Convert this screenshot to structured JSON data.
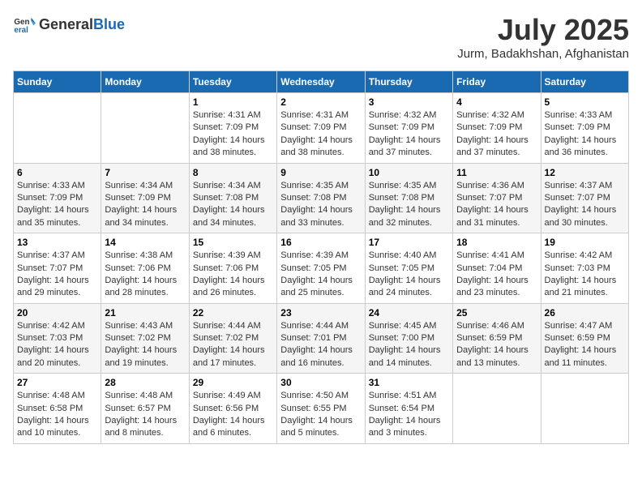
{
  "header": {
    "logo": {
      "general": "General",
      "blue": "Blue"
    },
    "title": "July 2025",
    "location": "Jurm, Badakhshan, Afghanistan"
  },
  "days_of_week": [
    "Sunday",
    "Monday",
    "Tuesday",
    "Wednesday",
    "Thursday",
    "Friday",
    "Saturday"
  ],
  "weeks": [
    [
      null,
      null,
      {
        "day": 1,
        "sunrise": "4:31 AM",
        "sunset": "7:09 PM",
        "daylight": "14 hours and 38 minutes."
      },
      {
        "day": 2,
        "sunrise": "4:31 AM",
        "sunset": "7:09 PM",
        "daylight": "14 hours and 38 minutes."
      },
      {
        "day": 3,
        "sunrise": "4:32 AM",
        "sunset": "7:09 PM",
        "daylight": "14 hours and 37 minutes."
      },
      {
        "day": 4,
        "sunrise": "4:32 AM",
        "sunset": "7:09 PM",
        "daylight": "14 hours and 37 minutes."
      },
      {
        "day": 5,
        "sunrise": "4:33 AM",
        "sunset": "7:09 PM",
        "daylight": "14 hours and 36 minutes."
      }
    ],
    [
      {
        "day": 6,
        "sunrise": "4:33 AM",
        "sunset": "7:09 PM",
        "daylight": "14 hours and 35 minutes."
      },
      {
        "day": 7,
        "sunrise": "4:34 AM",
        "sunset": "7:09 PM",
        "daylight": "14 hours and 34 minutes."
      },
      {
        "day": 8,
        "sunrise": "4:34 AM",
        "sunset": "7:08 PM",
        "daylight": "14 hours and 34 minutes."
      },
      {
        "day": 9,
        "sunrise": "4:35 AM",
        "sunset": "7:08 PM",
        "daylight": "14 hours and 33 minutes."
      },
      {
        "day": 10,
        "sunrise": "4:35 AM",
        "sunset": "7:08 PM",
        "daylight": "14 hours and 32 minutes."
      },
      {
        "day": 11,
        "sunrise": "4:36 AM",
        "sunset": "7:07 PM",
        "daylight": "14 hours and 31 minutes."
      },
      {
        "day": 12,
        "sunrise": "4:37 AM",
        "sunset": "7:07 PM",
        "daylight": "14 hours and 30 minutes."
      }
    ],
    [
      {
        "day": 13,
        "sunrise": "4:37 AM",
        "sunset": "7:07 PM",
        "daylight": "14 hours and 29 minutes."
      },
      {
        "day": 14,
        "sunrise": "4:38 AM",
        "sunset": "7:06 PM",
        "daylight": "14 hours and 28 minutes."
      },
      {
        "day": 15,
        "sunrise": "4:39 AM",
        "sunset": "7:06 PM",
        "daylight": "14 hours and 26 minutes."
      },
      {
        "day": 16,
        "sunrise": "4:39 AM",
        "sunset": "7:05 PM",
        "daylight": "14 hours and 25 minutes."
      },
      {
        "day": 17,
        "sunrise": "4:40 AM",
        "sunset": "7:05 PM",
        "daylight": "14 hours and 24 minutes."
      },
      {
        "day": 18,
        "sunrise": "4:41 AM",
        "sunset": "7:04 PM",
        "daylight": "14 hours and 23 minutes."
      },
      {
        "day": 19,
        "sunrise": "4:42 AM",
        "sunset": "7:03 PM",
        "daylight": "14 hours and 21 minutes."
      }
    ],
    [
      {
        "day": 20,
        "sunrise": "4:42 AM",
        "sunset": "7:03 PM",
        "daylight": "14 hours and 20 minutes."
      },
      {
        "day": 21,
        "sunrise": "4:43 AM",
        "sunset": "7:02 PM",
        "daylight": "14 hours and 19 minutes."
      },
      {
        "day": 22,
        "sunrise": "4:44 AM",
        "sunset": "7:02 PM",
        "daylight": "14 hours and 17 minutes."
      },
      {
        "day": 23,
        "sunrise": "4:44 AM",
        "sunset": "7:01 PM",
        "daylight": "14 hours and 16 minutes."
      },
      {
        "day": 24,
        "sunrise": "4:45 AM",
        "sunset": "7:00 PM",
        "daylight": "14 hours and 14 minutes."
      },
      {
        "day": 25,
        "sunrise": "4:46 AM",
        "sunset": "6:59 PM",
        "daylight": "14 hours and 13 minutes."
      },
      {
        "day": 26,
        "sunrise": "4:47 AM",
        "sunset": "6:59 PM",
        "daylight": "14 hours and 11 minutes."
      }
    ],
    [
      {
        "day": 27,
        "sunrise": "4:48 AM",
        "sunset": "6:58 PM",
        "daylight": "14 hours and 10 minutes."
      },
      {
        "day": 28,
        "sunrise": "4:48 AM",
        "sunset": "6:57 PM",
        "daylight": "14 hours and 8 minutes."
      },
      {
        "day": 29,
        "sunrise": "4:49 AM",
        "sunset": "6:56 PM",
        "daylight": "14 hours and 6 minutes."
      },
      {
        "day": 30,
        "sunrise": "4:50 AM",
        "sunset": "6:55 PM",
        "daylight": "14 hours and 5 minutes."
      },
      {
        "day": 31,
        "sunrise": "4:51 AM",
        "sunset": "6:54 PM",
        "daylight": "14 hours and 3 minutes."
      },
      null,
      null
    ]
  ],
  "labels": {
    "sunrise": "Sunrise:",
    "sunset": "Sunset:",
    "daylight": "Daylight:"
  }
}
